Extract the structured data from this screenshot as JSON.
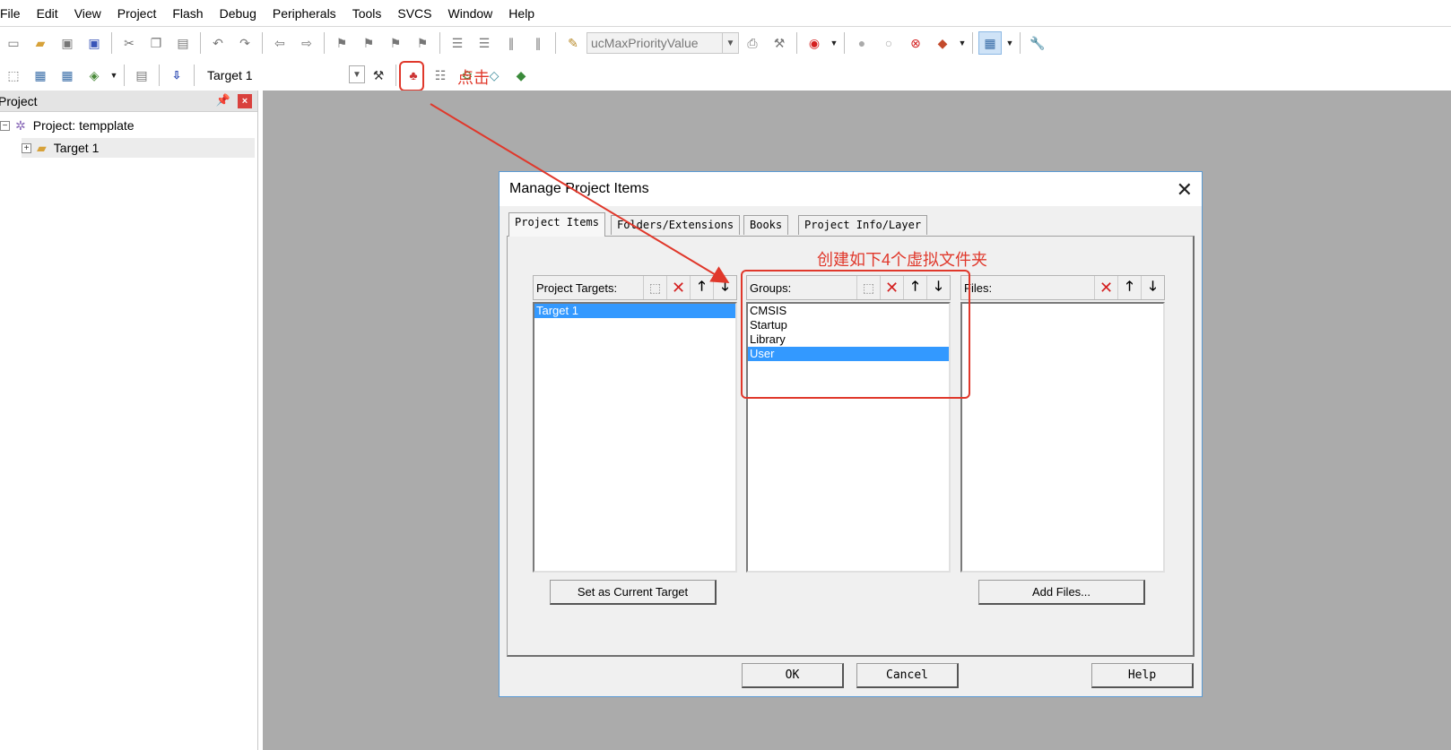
{
  "menu": [
    "File",
    "Edit",
    "View",
    "Project",
    "Flash",
    "Debug",
    "Peripherals",
    "Tools",
    "SVCS",
    "Window",
    "Help"
  ],
  "toolbar": {
    "find_combo_value": "ucMaxPriorityValue",
    "target_combo_value": "Target 1"
  },
  "project_panel": {
    "title": "Project",
    "tree": {
      "root_label": "Project: tempplate",
      "target_label": "Target 1"
    }
  },
  "dialog": {
    "title": "Manage Project Items",
    "tabs": [
      "Project Items",
      "Folders/Extensions",
      "Books",
      "Project Info/Layer"
    ],
    "annotation": "创建如下4个虚拟文件夹",
    "click_annotation": "点击",
    "panes": {
      "targets": {
        "label": "Project Targets:",
        "items": [
          "Target 1"
        ],
        "selected": "Target 1"
      },
      "groups": {
        "label": "Groups:",
        "items": [
          "CMSIS",
          "Startup",
          "Library",
          "User"
        ],
        "selected": "User"
      },
      "files": {
        "label": "Files:",
        "items": []
      }
    },
    "buttons": {
      "set_current": "Set as Current Target",
      "add_files": "Add Files...",
      "ok": "OK",
      "cancel": "Cancel",
      "help": "Help"
    }
  },
  "colors": {
    "annotation_red": "#e0382b",
    "selection_blue": "#3399ff",
    "workspace_gray": "#ababab"
  }
}
